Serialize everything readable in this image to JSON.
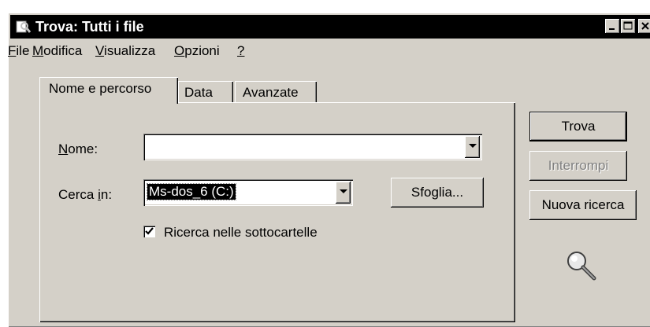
{
  "window": {
    "title": "Trova: Tutti i file"
  },
  "menu": [
    {
      "label": "File",
      "mnemonic": "F"
    },
    {
      "label": "Modifica",
      "mnemonic": "M"
    },
    {
      "label": "Visualizza",
      "mnemonic": "V"
    },
    {
      "label": "Opzioni",
      "mnemonic": "O"
    },
    {
      "label": "?",
      "mnemonic": "?"
    }
  ],
  "tabs": [
    {
      "label": "Nome e percorso",
      "active": true
    },
    {
      "label": "Data",
      "active": false
    },
    {
      "label": "Avanzate",
      "active": false
    }
  ],
  "form": {
    "nome_label": "Nome:",
    "nome_value": "",
    "cerca_in_label": "Cerca in:",
    "cerca_in_value": "Ms-dos_6 (C:)",
    "sfoglia_label": "Sfoglia...",
    "subfolders_label": "Ricerca nelle sottocartelle",
    "subfolders_checked": true
  },
  "actions": {
    "trova_label": "Trova",
    "interrompi_label": "Interrompi",
    "nuova_ricerca_label": "Nuova ricerca"
  },
  "icons": {
    "app": "find-files-icon",
    "search": "magnifier-icon",
    "minimize": "minimize-icon",
    "maximize": "maximize-icon",
    "close": "close-icon",
    "dropdown": "chevron-down-icon",
    "check": "checkmark-icon"
  },
  "colors": {
    "face": "#d4d0c8",
    "titlebar": "#000000",
    "title_text": "#ffffff",
    "field": "#ffffff",
    "disabled_text": "#808080"
  }
}
